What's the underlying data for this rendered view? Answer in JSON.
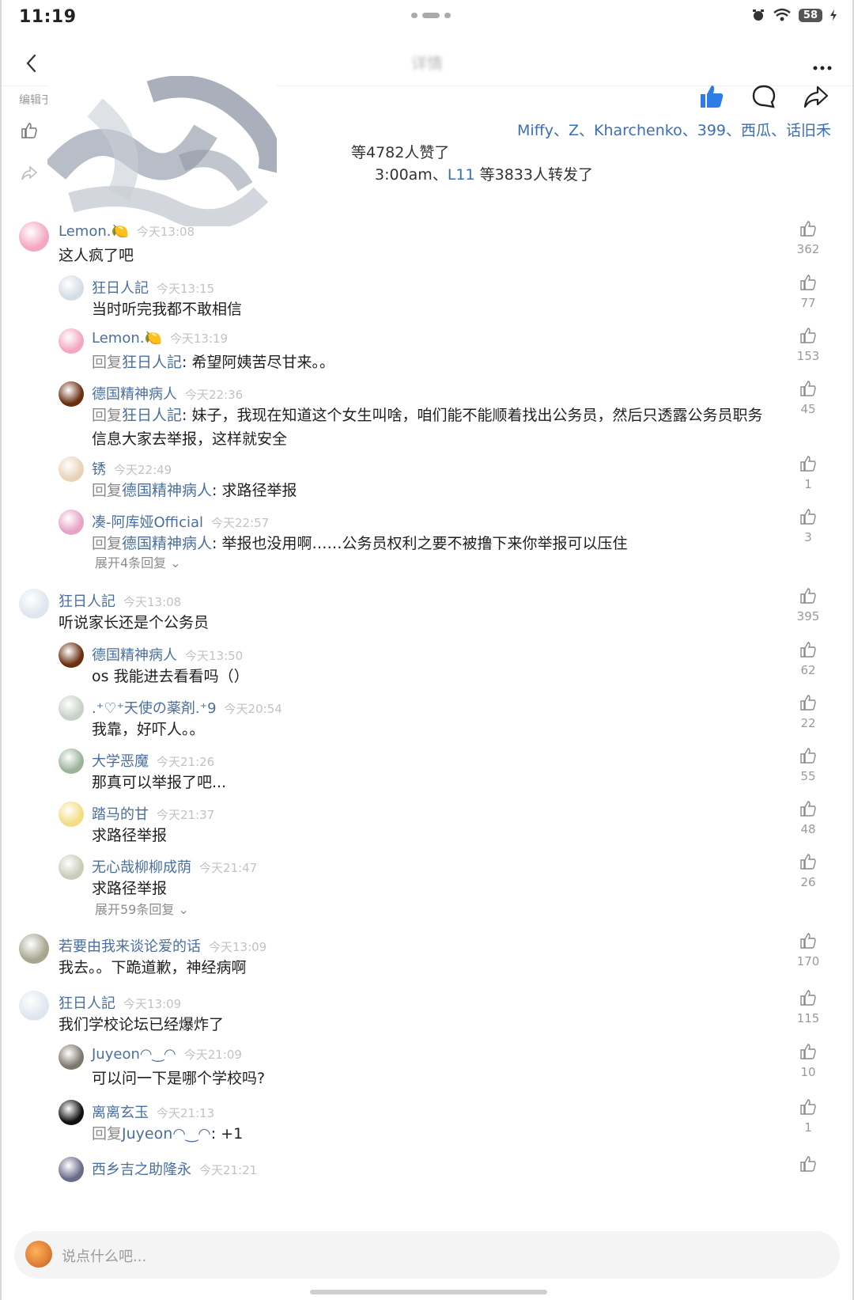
{
  "status": {
    "time": "11:19",
    "battery": "58"
  },
  "nav": {
    "title": "详情"
  },
  "post": {
    "editor": "编辑于今",
    "likes_line1": "Miffy、Z、Kharchenko、399、西瓜、话旧禾",
    "likes_line2": "等4782人赞了",
    "share_time": "3:00am、",
    "share_user": "L11",
    "share_suffix": " 等3833人转发了"
  },
  "comments": [
    {
      "name": "Lemon.🍋",
      "time": "今天13:08",
      "text": "这人疯了吧",
      "likes": "362",
      "level": 0
    },
    {
      "name": "狂日人記",
      "time": "今天13:15",
      "text": "当时听完我都不敢相信",
      "likes": "77",
      "level": 1
    },
    {
      "name": "Lemon.🍋",
      "time": "今天13:19",
      "reply_to": "狂日人記",
      "text": "希望阿姨苦尽甘来。。",
      "likes": "153",
      "level": 1
    },
    {
      "name": "德国精神病人",
      "time": "今天22:36",
      "reply_to": "狂日人記",
      "text": "妹子，我现在知道这个女生叫啥，咱们能不能顺着找出公务员，然后只透露公务员职务",
      "text2": "信息大家去举报，这样就安全",
      "likes": "45",
      "level": 1
    },
    {
      "name": "锈",
      "time": "今天22:49",
      "reply_to": "德国精神病人",
      "text": "求路径举报",
      "likes": "1",
      "level": 1
    },
    {
      "name": "凑-阿库娅Official",
      "time": "今天22:57",
      "reply_to": "德国精神病人",
      "text": "举报也没用啊……公务员权利之要不被撸下来你举报可以压住",
      "likes": "3",
      "level": 1
    },
    {
      "name": "狂日人記",
      "time": "今天13:08",
      "text": "听说家长还是个公务员",
      "likes": "395",
      "level": 0
    },
    {
      "name": "德国精神病人",
      "time": "今天13:50",
      "text": "os 我能进去看看吗（）",
      "likes": "62",
      "level": 1
    },
    {
      "name": ".⁺♡⁺天使の薬剤.⁺9",
      "time": "今天20:54",
      "text": "我靠，好吓人。。",
      "likes": "22",
      "level": 1
    },
    {
      "name": "大学恶魔",
      "time": "今天21:26",
      "text": "那真可以举报了吧...",
      "likes": "55",
      "level": 1
    },
    {
      "name": "踏马的甘",
      "time": "今天21:37",
      "text": "求路径举报",
      "likes": "48",
      "level": 1
    },
    {
      "name": "无心哉柳柳成荫",
      "time": "今天21:47",
      "text": "求路径举报",
      "likes": "26",
      "level": 1
    },
    {
      "name": "若要由我来谈论爱的话",
      "time": "今天13:09",
      "text": "我去。。下跪道歉，神经病啊",
      "likes": "170",
      "level": 0
    },
    {
      "name": "狂日人記",
      "time": "今天13:09",
      "text": "我们学校论坛已经爆炸了",
      "likes": "115",
      "level": 0
    },
    {
      "name": "Juyeon◠‿◠",
      "time": "今天21:09",
      "text": "可以问一下是哪个学校吗?",
      "likes": "10",
      "level": 1
    },
    {
      "name": "离离玄玉",
      "time": "今天21:13",
      "reply_to": "Juyeon◠‿◠",
      "text": "+1",
      "likes": "1",
      "level": 1
    },
    {
      "name": "西乡吉之助隆永",
      "time": "今天21:21",
      "text": "",
      "likes": "",
      "level": 1
    }
  ],
  "expand1": "展开4条回复",
  "expand2": "展开59条回复",
  "reply_prefix": "回复",
  "input_placeholder": "说点什么吧..."
}
